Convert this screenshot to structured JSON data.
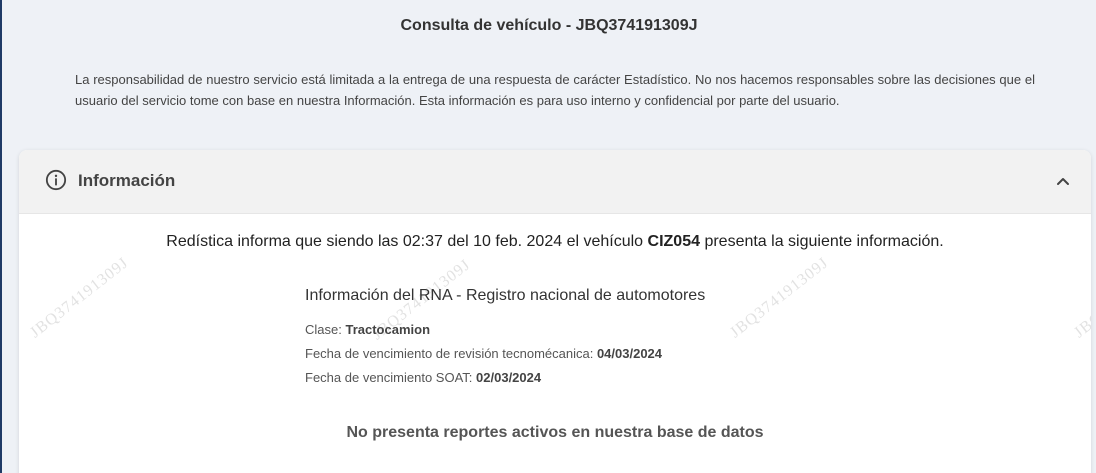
{
  "page": {
    "title": "Consulta de vehículo - JBQ374191309J",
    "disclaimer": "La responsabilidad de nuestro servicio está limitada a la entrega de una respuesta de carácter Estadístico. No nos hacemos responsables sobre las decisiones que el usuario del servicio tome con base en nuestra Información. Esta información es para uso interno y confidencial por parte del usuario."
  },
  "card": {
    "title": "Información",
    "icon": "info-circle-icon",
    "collapse_icon": "chevron-up-icon",
    "watermark": "JBQ374191309J",
    "intro": {
      "prefix": "Redística informa que siendo las 02:37 del 10 feb. 2024 el vehículo",
      "plate": "CIZ054",
      "suffix": "presenta la siguiente información."
    },
    "rna": {
      "title": "Información del RNA - Registro nacional de automotores",
      "clase_label": "Clase:",
      "clase_value": "Tractocamion",
      "tecno_label": "Fecha de vencimiento de revisión tecnomécanica:",
      "tecno_value": "04/03/2024",
      "soat_label": "Fecha de vencimiento SOAT:",
      "soat_value": "02/03/2024"
    },
    "no_reports": "No presenta reportes activos en nuestra base de datos"
  }
}
